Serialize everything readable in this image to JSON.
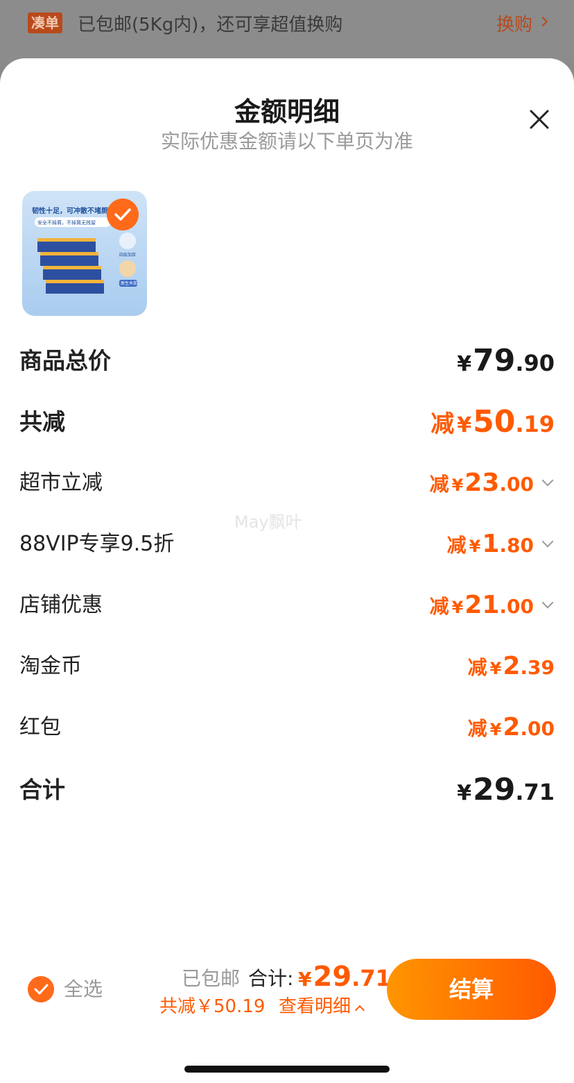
{
  "promo": {
    "tag": "凑单",
    "text": "已包邮(5Kg内)，还可享超值换购",
    "link": "换购"
  },
  "sheet": {
    "title": "金额明细",
    "subtitle": "实际优惠金额请以下单页为准"
  },
  "product": {
    "image_text_1": "韧性十足，可冲散不堵厕",
    "image_text_2": "安全不掉屑，不掉屑无残留",
    "image_tag_1": "四层加厚",
    "image_tag_2": "原生木浆"
  },
  "breakdown": {
    "subtotal": {
      "label": "商品总价",
      "prefix": "",
      "yen": "¥",
      "int": "79",
      "dec": ".90"
    },
    "discount_total": {
      "label": "共减",
      "prefix": "减",
      "yen": "¥",
      "int": "50",
      "dec": ".19"
    },
    "items": [
      {
        "label": "超市立减",
        "prefix": "减",
        "yen": "¥",
        "int": "23",
        "dec": ".00",
        "expandable": true
      },
      {
        "label": "88VIP专享9.5折",
        "prefix": "减",
        "yen": "¥",
        "int": "1",
        "dec": ".80",
        "expandable": true
      },
      {
        "label": "店铺优惠",
        "prefix": "减",
        "yen": "¥",
        "int": "21",
        "dec": ".00",
        "expandable": true
      },
      {
        "label": "淘金币",
        "prefix": "减",
        "yen": "¥",
        "int": "2",
        "dec": ".39",
        "expandable": false
      },
      {
        "label": "红包",
        "prefix": "减",
        "yen": "¥",
        "int": "2",
        "dec": ".00",
        "expandable": false
      }
    ],
    "grand_total": {
      "label": "合计",
      "prefix": "",
      "yen": "¥",
      "int": "29",
      "dec": ".71"
    }
  },
  "watermark": "May飘叶",
  "bottom_bar": {
    "select_all": "全选",
    "shipping": "已包邮",
    "total_label": "合计:",
    "total_yen": "¥",
    "total_int": "29",
    "total_dec": ".71",
    "saved": "共减￥50.19",
    "view_detail": "查看明细",
    "checkout": "结算"
  },
  "colors": {
    "accent": "#ff5a00",
    "checkout_gradient_start": "#ff9500",
    "checkout_gradient_end": "#ff5a00"
  }
}
